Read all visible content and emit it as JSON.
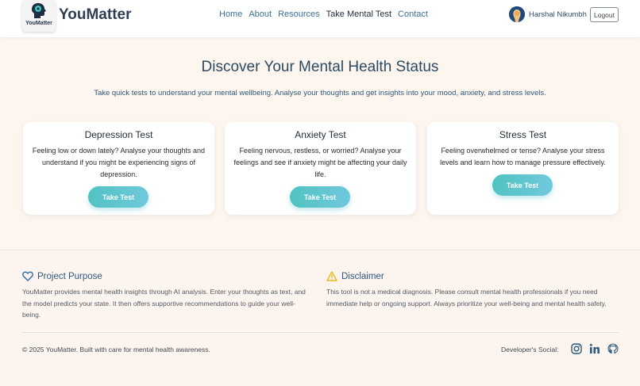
{
  "header": {
    "logo_text": "YouMatter",
    "brand": "YouMatter",
    "nav": [
      {
        "label": "Home"
      },
      {
        "label": "About"
      },
      {
        "label": "Resources"
      },
      {
        "label": "Take Mental Test",
        "active": true
      },
      {
        "label": "Contact"
      }
    ],
    "user_name": "Harshal Nikumbh",
    "logout_label": "Logout"
  },
  "hero": {
    "title": "Discover Your Mental Health Status",
    "subtitle": "Take quick tests to understand your mental wellbeing. Analyse your thoughts and get insights into your mood, anxiety, and stress levels."
  },
  "cards": [
    {
      "title": "Depression Test",
      "description": "Feeling low or down lately? Analyse your thoughts and understand if you might be experiencing signs of depression.",
      "button": "Take Test"
    },
    {
      "title": "Anxiety Test",
      "description": "Feeling nervous, restless, or worried? Analyse your feelings and see if anxiety might be affecting your daily life.",
      "button": "Take Test"
    },
    {
      "title": "Stress Test",
      "description": "Feeling overwhelmed or tense? Analyse your stress levels and learn how to manage pressure effectively.",
      "button": "Take Test"
    }
  ],
  "footer": {
    "purpose_title": "Project Purpose",
    "purpose_text": "YouMatter provides mental health insights through AI analysis. Enter your thoughts as text, and the model predicts your state. It then offers supportive recommendations to guide your well-being.",
    "disclaimer_title": "Disclaimer",
    "disclaimer_text": "This tool is not a medical diagnosis. Please consult mental health professionals if you need immediate help or ongoing support. Always prioritize your well-being and mental health safety.",
    "copyright": "© 2025 YouMatter. Built with care for mental health awareness.",
    "developer_social": "Developer's Social:",
    "social_icons": [
      "instagram-icon",
      "linkedin-icon",
      "github-icon"
    ]
  },
  "colors": {
    "accent": "#51c3c1",
    "accent_end": "#70c8dd",
    "brand_text": "#2d3e54",
    "nav_link": "#3a6f93",
    "background": "#fdf6ef"
  }
}
